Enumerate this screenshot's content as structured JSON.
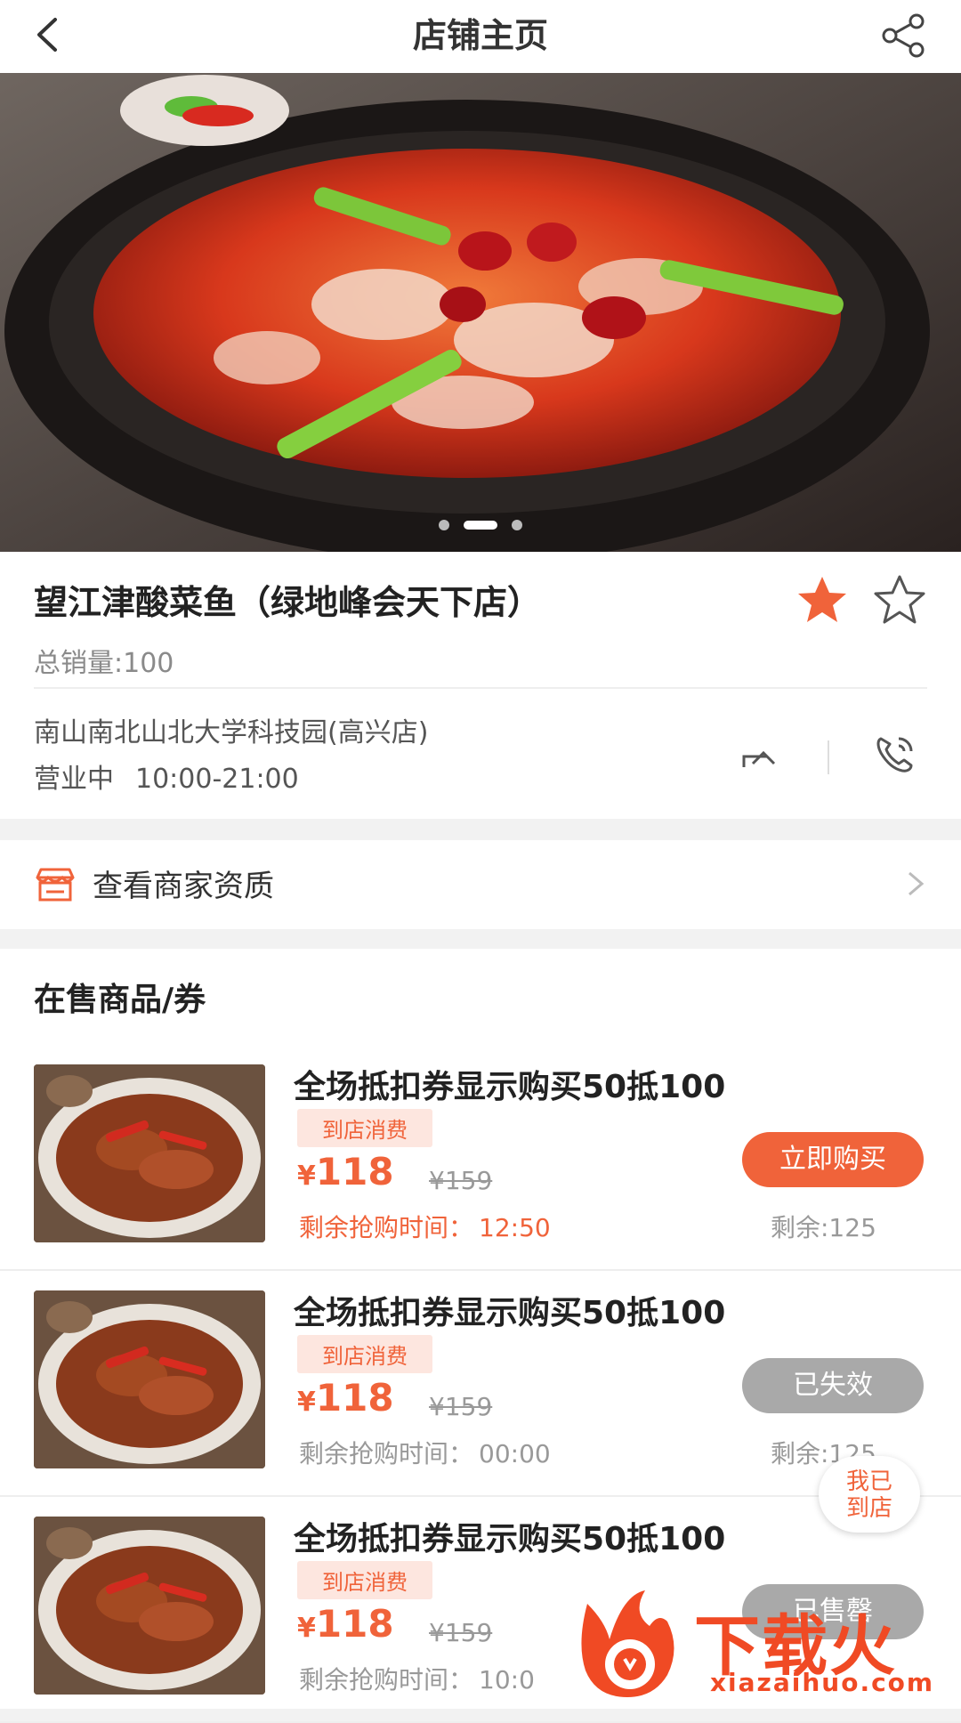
{
  "header": {
    "title": "店铺主页",
    "back_icon": "chevron-left-icon",
    "share_icon": "share-icon"
  },
  "banner": {
    "slide_count": 3,
    "active_slide": 2
  },
  "shop": {
    "name": "望江津酸菜鱼（绿地峰会天下店）",
    "sales": "总销量:100",
    "address": "南山南北山北大学科技园(高兴店)",
    "status": "营业中",
    "hours": "10:00-21:00",
    "accent": "#f0633a"
  },
  "qualification": {
    "label": "查看商家资质"
  },
  "section_title": "在售商品/券",
  "items": [
    {
      "name": "全场抵扣券显示购买50抵100",
      "tag": "到店消费",
      "price_symbol": "¥",
      "price": "118",
      "original": "¥159",
      "timer_label": "剩余抢购时间：",
      "timer_value": "12:50",
      "button": "立即购买",
      "remain": "剩余:125"
    },
    {
      "name": "全场抵扣券显示购买50抵100",
      "tag": "到店消费",
      "price_symbol": "¥",
      "price": "118",
      "original": "¥159",
      "timer_label": "剩余抢购时间：",
      "timer_value": "00:00",
      "button": "已失效",
      "remain": "剩余:125"
    },
    {
      "name": "全场抵扣券显示购买50抵100",
      "tag": "到店消费",
      "price_symbol": "¥",
      "price": "118",
      "original": "¥159",
      "timer_label": "剩余抢购时间：",
      "timer_value": "10:0",
      "button": "已售罄",
      "remain": ""
    }
  ],
  "floating": {
    "arrived_line1": "我已",
    "arrived_line2": "到店"
  },
  "watermark": {
    "brand": "下载火",
    "url": "xiazaihuo.com"
  }
}
